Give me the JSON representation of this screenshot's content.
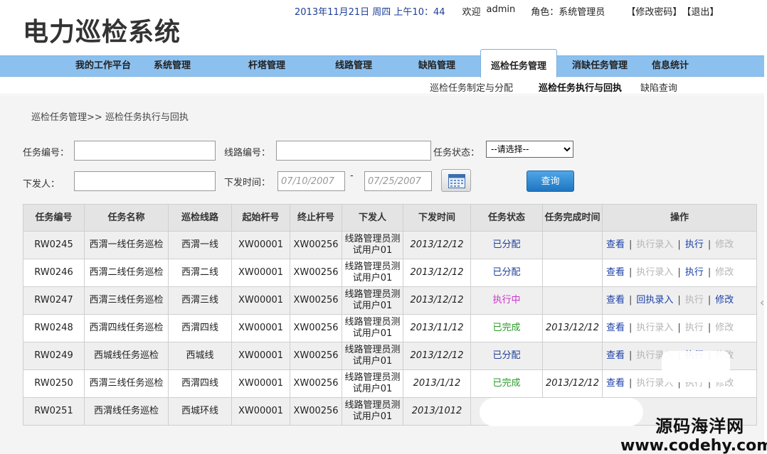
{
  "header": {
    "app_title": "电力巡检系统",
    "datetime": "2013年11月21日 周四 上午10：44",
    "welcome": "欢迎",
    "user": "admin",
    "role_label": "角色：",
    "role_value": "系统管理员",
    "change_password": "【修改密码】",
    "logout": "【退出】"
  },
  "nav": {
    "items": [
      "我的工作平台",
      "系统管理",
      "杆塔管理",
      "线路管理",
      "缺陷管理",
      "巡检任务管理",
      "消缺任务管理",
      "信息统计"
    ],
    "active": "巡检任务管理"
  },
  "subnav": {
    "items": [
      "巡检任务制定与分配",
      "巡检任务执行与回执",
      "缺陷查询"
    ],
    "current": "巡检任务执行与回执"
  },
  "breadcrumb": "巡检任务管理>> 巡检任务执行与回执",
  "search": {
    "task_no_label": "任务编号：",
    "task_no_value": "",
    "line_no_label": "线路编号：",
    "line_no_value": "",
    "status_label": "任务状态：",
    "status_selected": "--请选择--",
    "issuer_label": "下发人：",
    "issuer_value": "",
    "issue_time_label": "下发时间：",
    "date_from": "07/10/2007",
    "date_to": "07/25/2007",
    "range_sep": "-",
    "query_button": "查询"
  },
  "table": {
    "headers": [
      "任务编号",
      "任务名称",
      "巡检线路",
      "起始杆号",
      "终止杆号",
      "下发人",
      "下发时间",
      "任务状态",
      "任务完成时间",
      "操作"
    ],
    "rows": [
      {
        "id": "RW0245",
        "name": "西渭一线任务巡检",
        "line": "西渭一线",
        "start": "XW00001",
        "end": "XW00256",
        "issuer": "线路管理员测试用户01",
        "issue_time": "2013/12/12",
        "status": "已分配",
        "finish_time": "",
        "ops": [
          {
            "label": "查看",
            "state": "link"
          },
          {
            "label": "执行录入",
            "state": "disabled"
          },
          {
            "label": "执行",
            "state": "link"
          },
          {
            "label": "修改",
            "state": "disabled"
          }
        ]
      },
      {
        "id": "RW0246",
        "name": "西渭二线任务巡检",
        "line": "西渭二线",
        "start": "XW00001",
        "end": "XW00256",
        "issuer": "线路管理员测试用户01",
        "issue_time": "2013/12/12",
        "status": "已分配",
        "finish_time": "",
        "ops": [
          {
            "label": "查看",
            "state": "link"
          },
          {
            "label": "执行录入",
            "state": "disabled"
          },
          {
            "label": "执行",
            "state": "link"
          },
          {
            "label": "修改",
            "state": "disabled"
          }
        ]
      },
      {
        "id": "RW0247",
        "name": "西渭三线任务巡检",
        "line": "西渭三线",
        "start": "XW00001",
        "end": "XW00256",
        "issuer": "线路管理员测试用户01",
        "issue_time": "2013/12/12",
        "status": "执行中",
        "finish_time": "",
        "ops": [
          {
            "label": "查看",
            "state": "link"
          },
          {
            "label": "回执录入",
            "state": "link"
          },
          {
            "label": "执行",
            "state": "disabled"
          },
          {
            "label": "修改",
            "state": "link"
          }
        ]
      },
      {
        "id": "RW0248",
        "name": "西渭四线任务巡检",
        "line": "西渭四线",
        "start": "XW00001",
        "end": "XW00256",
        "issuer": "线路管理员测试用户01",
        "issue_time": "2013/11/12",
        "status": "已完成",
        "finish_time": "2013/12/12",
        "ops": [
          {
            "label": "查看",
            "state": "link"
          },
          {
            "label": "执行录入",
            "state": "disabled"
          },
          {
            "label": "执行",
            "state": "disabled"
          },
          {
            "label": "修改",
            "state": "disabled"
          }
        ]
      },
      {
        "id": "RW0249",
        "name": "西城线任务巡检",
        "line": "西城线",
        "start": "XW00001",
        "end": "XW00256",
        "issuer": "线路管理员测试用户01",
        "issue_time": "2013/12/12",
        "status": "已分配",
        "finish_time": "",
        "ops": [
          {
            "label": "查看",
            "state": "link"
          },
          {
            "label": "执行录入",
            "state": "disabled"
          },
          {
            "label": "执行",
            "state": "link"
          },
          {
            "label": "修改",
            "state": "disabled"
          }
        ]
      },
      {
        "id": "RW0250",
        "name": "西渭三线任务巡检",
        "line": "西渭四线",
        "start": "XW00001",
        "end": "XW00256",
        "issuer": "线路管理员测试用户01",
        "issue_time": "2013/1/12",
        "status": "已完成",
        "finish_time": "2013/12/12",
        "ops": [
          {
            "label": "查看",
            "state": "link"
          },
          {
            "label": "执行录入",
            "state": "disabled"
          },
          {
            "label": "执行",
            "state": "disabled"
          },
          {
            "label": "修改",
            "state": "disabled"
          }
        ]
      },
      {
        "id": "RW0251",
        "name": "西渭线任务巡检",
        "line": "西城环线",
        "start": "XW00001",
        "end": "XW00256",
        "issuer": "线路管理员测试用户01",
        "issue_time": "2013/1012",
        "status": "",
        "finish_time": "",
        "ops": []
      }
    ]
  },
  "status_colors": {
    "已分配": "#1f3f99",
    "执行中": "#cc33cc",
    "已完成": "#2a9a2a"
  },
  "watermark": {
    "line1": "源码海洋网",
    "line2": "www.codehy.com"
  }
}
